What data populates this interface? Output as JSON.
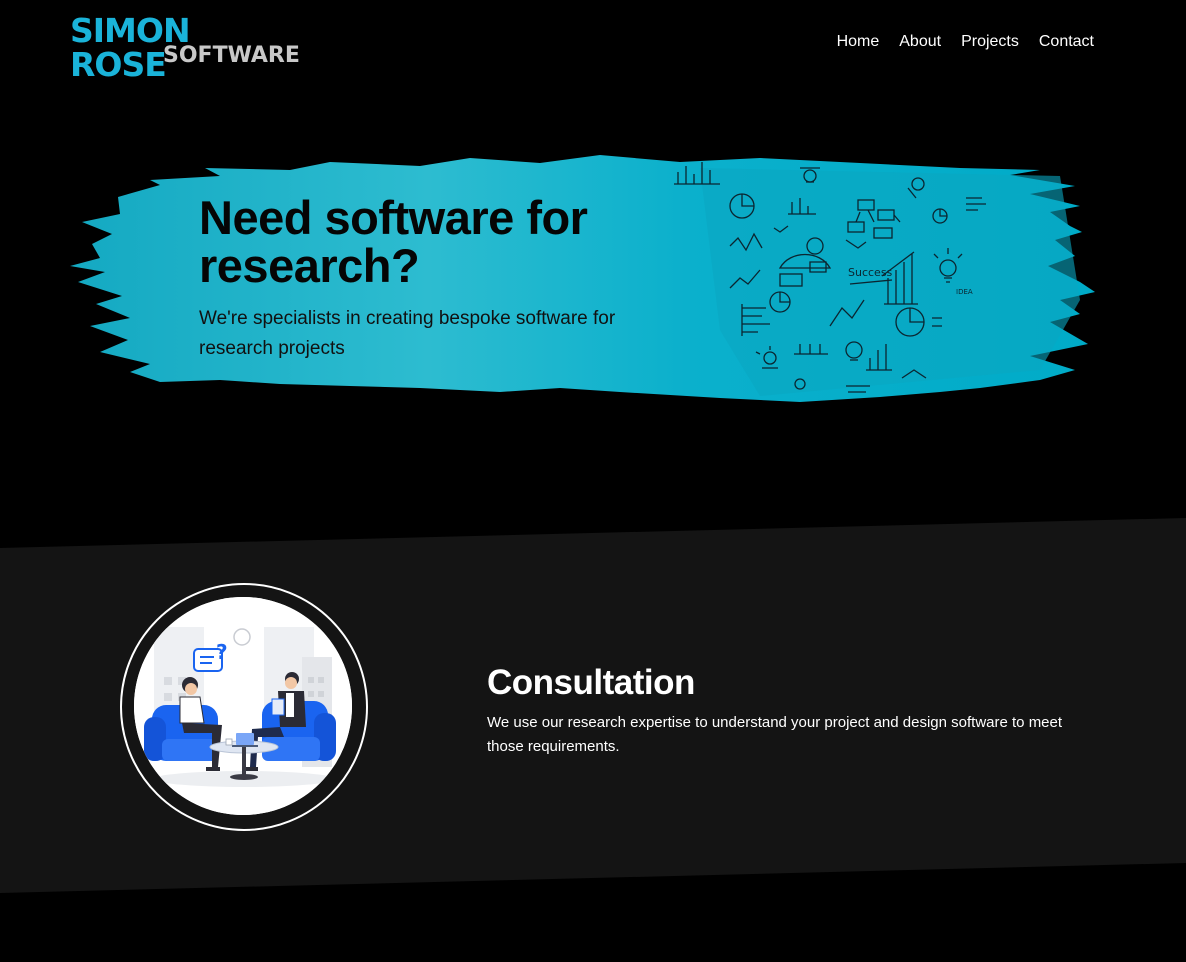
{
  "header": {
    "logo": {
      "line1": "SIMON ROSE",
      "line2": "SOFTWARE"
    },
    "nav": [
      "Home",
      "About",
      "Projects",
      "Contact"
    ]
  },
  "hero": {
    "title": "Need software for research?",
    "subtitle": "We're specialists in creating bespoke software for research projects",
    "doodle_text": {
      "success": "Success",
      "idea": "IDEA"
    }
  },
  "section": {
    "title": "Consultation",
    "text": "We use our research expertise to understand your project and design software to meet those requirements."
  },
  "colors": {
    "accent": "#00b6d4",
    "logo_cyan": "#1ab3d9",
    "logo_gray": "#c8c8c8",
    "band": "#141414",
    "illustration_blue": "#1a64f0"
  },
  "icons": [
    "brush-stroke",
    "research-doodles",
    "consultation-illustration"
  ]
}
